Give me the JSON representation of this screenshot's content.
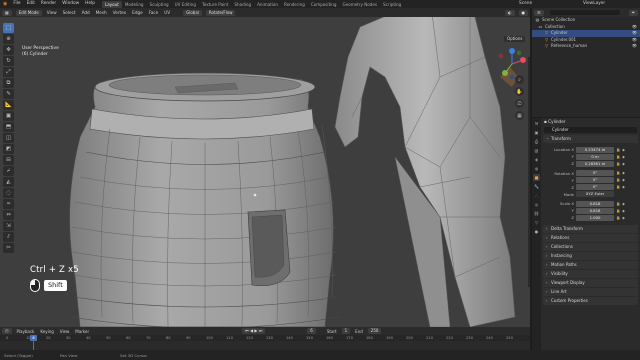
{
  "topbar": {
    "menus": [
      "File",
      "Edit",
      "Render",
      "Window",
      "Help"
    ],
    "workspaces": [
      "Layout",
      "Modeling",
      "Sculpting",
      "UV Editing",
      "Texture Paint",
      "Shading",
      "Animation",
      "Rendering",
      "Compositing",
      "Geometry Nodes",
      "Scripting"
    ],
    "active_workspace": "Layout",
    "scene_label": "Scene",
    "view_layer_label": "ViewLayer"
  },
  "viewport_header": {
    "mode": "Edit Mode",
    "menus": [
      "View",
      "Select",
      "Add",
      "Mesh",
      "Vertex",
      "Edge",
      "Face",
      "UV"
    ],
    "proportional": "Global",
    "snap": "Rotate/Flow"
  },
  "viewport": {
    "view_name": "User Perspective",
    "object_label": "(6) Cylinder",
    "options_label": "Options",
    "tools": [
      {
        "icon": "select-box-icon",
        "glyph": "⬚"
      },
      {
        "icon": "cursor-icon",
        "glyph": "⊕"
      },
      {
        "icon": "move-icon",
        "glyph": "✥"
      },
      {
        "icon": "rotate-icon",
        "glyph": "↻"
      },
      {
        "icon": "scale-icon",
        "glyph": "⤢"
      },
      {
        "icon": "transform-icon",
        "glyph": "⧉"
      },
      {
        "icon": "annotate-icon",
        "glyph": "✎"
      },
      {
        "icon": "measure-icon",
        "glyph": "📐"
      },
      {
        "icon": "add-cube-icon",
        "glyph": "▣"
      },
      {
        "icon": "extrude-icon",
        "glyph": "⬒"
      },
      {
        "icon": "inset-icon",
        "glyph": "◫"
      },
      {
        "icon": "bevel-icon",
        "glyph": "◩"
      },
      {
        "icon": "loop-cut-icon",
        "glyph": "⊟"
      },
      {
        "icon": "knife-icon",
        "glyph": "⌿"
      },
      {
        "icon": "poly-build-icon",
        "glyph": "◭"
      },
      {
        "icon": "spin-icon",
        "glyph": "◌"
      },
      {
        "icon": "smooth-icon",
        "glyph": "≈"
      },
      {
        "icon": "edge-slide-icon",
        "glyph": "⇔"
      },
      {
        "icon": "shrink-icon",
        "glyph": "⇲"
      },
      {
        "icon": "shear-icon",
        "glyph": "⫽"
      },
      {
        "icon": "rip-icon",
        "glyph": "✂"
      }
    ]
  },
  "keystroke_overlay": {
    "shortcut": "Ctrl + Z x5",
    "modifier": "Shift"
  },
  "timeline": {
    "menus": [
      "Playback",
      "Keying",
      "View",
      "Marker"
    ],
    "start_label": "Start",
    "start_value": "1",
    "end_label": "End",
    "end_value": "250",
    "current_frame": "6",
    "ticks": [
      "0",
      "10",
      "20",
      "30",
      "40",
      "50",
      "60",
      "70",
      "80",
      "90",
      "100",
      "110",
      "120",
      "130",
      "140",
      "150",
      "160",
      "170",
      "180",
      "190",
      "200",
      "210",
      "220",
      "230",
      "240",
      "250"
    ]
  },
  "statusbar": {
    "items": [
      "Select (Toggle)",
      "Pan View",
      "Set 3D Cursor"
    ]
  },
  "outliner": {
    "header": "Scene Collection",
    "items": [
      {
        "label": "Collection",
        "icon": "collection-icon",
        "glyph": "▭",
        "indent": 6,
        "selected": false
      },
      {
        "label": "Cylinder",
        "icon": "mesh-icon",
        "glyph": "▽",
        "indent": 12,
        "selected": true
      },
      {
        "label": "Cylinder.001",
        "icon": "mesh-icon",
        "glyph": "▽",
        "indent": 12,
        "selected": false
      },
      {
        "label": "Reference_human",
        "icon": "mesh-icon",
        "glyph": "▽",
        "indent": 12,
        "selected": false
      }
    ]
  },
  "properties": {
    "header": "Cylinder",
    "object_name": "Cylinder",
    "transform_label": "Transform",
    "location": {
      "label": "Location X",
      "x": "0.23474 m",
      "y_label": "Y",
      "y": "0 m",
      "z_label": "Z",
      "z": "0.28361 m"
    },
    "rotation": {
      "label": "Rotation X",
      "x": "0°",
      "y_label": "Y",
      "y": "0°",
      "z_label": "Z",
      "z": "0°"
    },
    "mode_label": "Mode",
    "mode_value": "XYZ Euler",
    "scale": {
      "label": "Scale X",
      "x": "0.818",
      "y_label": "Y",
      "y": "0.818",
      "z_label": "Z",
      "z": "1.000"
    },
    "panels": [
      "Delta Transform",
      "Relations",
      "Collections",
      "Instancing",
      "Motion Paths",
      "Visibility",
      "Viewport Display",
      "Line Art",
      "Custom Properties"
    ]
  }
}
